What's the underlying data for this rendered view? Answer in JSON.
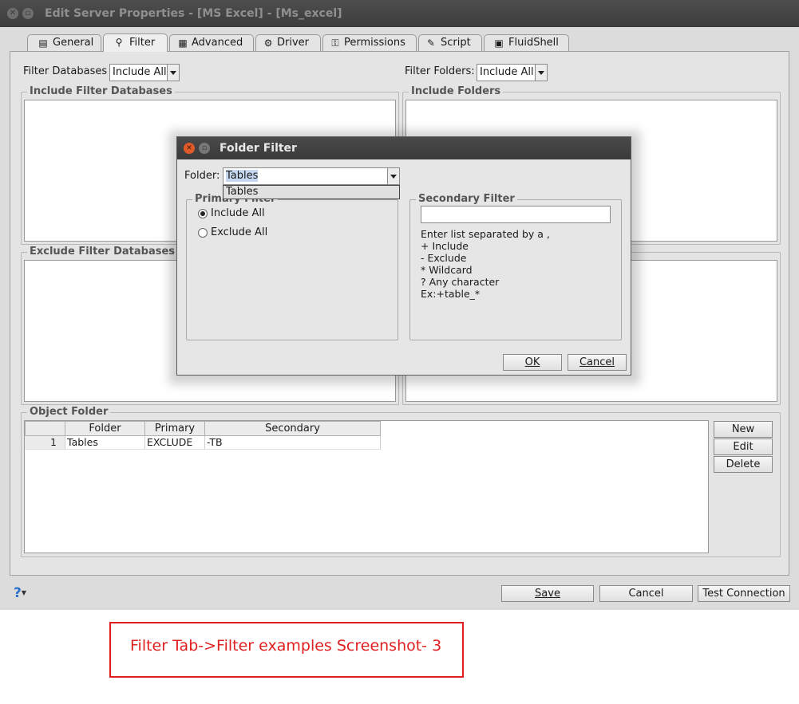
{
  "window": {
    "title": "Edit Server Properties - [MS Excel] - [Ms_excel]",
    "tabs": [
      {
        "label": "General",
        "icon": "general-icon"
      },
      {
        "label": "Filter",
        "icon": "filter-icon",
        "active": true
      },
      {
        "label": "Advanced",
        "icon": "advanced-icon"
      },
      {
        "label": "Driver",
        "icon": "driver-icon"
      },
      {
        "label": "Permissions",
        "icon": "permissions-icon"
      },
      {
        "label": "Script",
        "icon": "script-icon"
      },
      {
        "label": "FluidShell",
        "icon": "fluidshell-icon"
      }
    ]
  },
  "filter": {
    "databases_label": "Filter Databases",
    "databases_value": "Include All",
    "folders_label": "Filter Folders:",
    "folders_value": "Include All",
    "include_dbs_title": "Include Filter Databases",
    "include_folders_title": "Include Folders",
    "exclude_dbs_title": "Exclude Filter Databases"
  },
  "object_folder": {
    "title": "Object Folder",
    "columns": [
      "Folder",
      "Primary",
      "Secondary"
    ],
    "rows": [
      {
        "num": "1",
        "folder": "Tables",
        "primary": "EXCLUDE",
        "secondary": "-TB"
      }
    ],
    "buttons": {
      "new": "New",
      "edit": "Edit",
      "delete": "Delete"
    }
  },
  "bottom": {
    "help": "?",
    "save": "Save",
    "cancel": "Cancel",
    "test": "Test Connection"
  },
  "dialog": {
    "title": "Folder Filter",
    "folder_label": "Folder:",
    "folder_value": "Tables",
    "dropdown_option": "Tables",
    "primary_title": "Primary Filter",
    "include_all": "Include All",
    "exclude_all": "Exclude All",
    "secondary_title": "Secondary Filter",
    "secondary_value": "",
    "help_lines": [
      "Enter list separated by a ,",
      "+ Include",
      "- Exclude",
      "* Wildcard",
      "? Any character",
      "Ex:+table_*"
    ],
    "ok": "OK",
    "cancel": "Cancel"
  },
  "caption": "Filter Tab->Filter examples Screenshot- 3",
  "colors": {
    "accent_red": "#e02020",
    "title_bar": "#3c3c3c",
    "selection": "#c5d8ef"
  }
}
